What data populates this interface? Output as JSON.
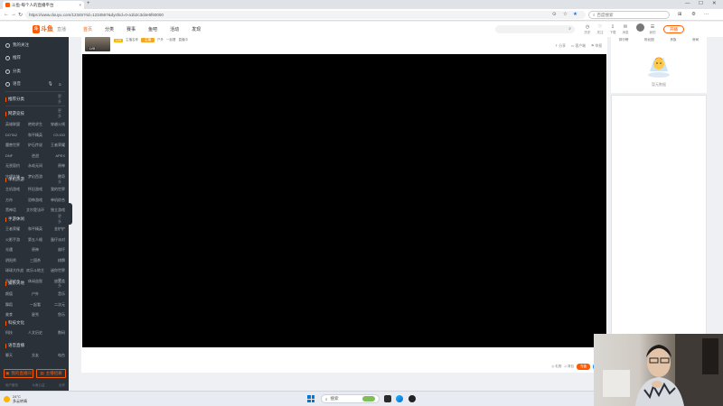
{
  "browser": {
    "tab_title": "斗鱼-每个人的直播平台",
    "url": "https://www.douyu.com/12345?rid=1234567&dyshid=0-a1b2c3d4e5f60000",
    "search_placeholder": "百度搜索"
  },
  "site": {
    "logo_mark": "斗",
    "logo_text": "斗鱼",
    "logo_sub": "直播",
    "nav": [
      "首页",
      "分类",
      "赛事",
      "鱼吧",
      "活动",
      "发现"
    ],
    "header_icons": [
      {
        "icon": "history-icon",
        "label": "历史"
      },
      {
        "icon": "follow-icon",
        "label": "关注"
      },
      {
        "icon": "download-icon",
        "label": "下载"
      },
      {
        "icon": "message-icon",
        "label": "消息"
      },
      {
        "icon": "user-icon",
        "label": "我的"
      }
    ],
    "start_live": "开播"
  },
  "sidebar": {
    "top_items": [
      "我的关注",
      "推荐",
      "分类"
    ],
    "voice_item": "语音",
    "sections": [
      {
        "title": "推荐分类",
        "more": "更多",
        "items": []
      },
      {
        "title": "网游竞技",
        "more": "更多",
        "items": [
          "英雄联盟",
          "绝地求生",
          "穿越火线",
          "DOTA2",
          "和平精英",
          "CS:GO",
          "魔兽世界",
          "炉石传说",
          "王者荣耀",
          "DNF",
          "逆战",
          "APEX",
          "无畏契约",
          "永劫无间",
          "原神",
          "守望先锋",
          "梦幻西游",
          "传奇"
        ]
      },
      {
        "title": "单机热游",
        "more": "更多",
        "items": [
          "主机游戏",
          "怀旧游戏",
          "我的世界",
          "方舟",
          "恐怖游戏",
          "单机综合",
          "黑神话",
          "艾尔登法环",
          "独立游戏"
        ]
      },
      {
        "title": "手游休闲",
        "more": "更多",
        "items": [
          "王者荣耀",
          "和平精英",
          "金铲铲",
          "火影手游",
          "第五人格",
          "蛋仔派对",
          "光遇",
          "原神",
          "崩坏",
          "阴阳师",
          "三国杀",
          "棋牌",
          "球球大作战",
          "欢乐斗地主",
          "迷你世界",
          "手游综合",
          "休闲益智",
          "放置类"
        ]
      },
      {
        "title": "娱乐天地",
        "more": "更多",
        "items": [
          "颜值",
          "户外",
          "音乐",
          "舞蹈",
          "一起看",
          "二次元",
          "美食",
          "星秀",
          "鱼乐"
        ]
      },
      {
        "title": "科技文化",
        "more": "",
        "items": [
          "科技",
          "人文历史",
          "数码"
        ]
      },
      {
        "title": "语音直播",
        "more": "",
        "items": [
          "聊天",
          "交友",
          "电台"
        ]
      }
    ],
    "btn_left": "我的直播间",
    "btn_right": "主播招募",
    "footer": [
      "用户服务",
      "斗鱼公益",
      "合作"
    ]
  },
  "room": {
    "badge": "LV8",
    "level": "LV9",
    "level2": "主播",
    "meta_name": "主播名称",
    "meta_tags": [
      "户外",
      "一起看",
      "直播中"
    ],
    "actions": [
      "分享",
      "客户端",
      "举报"
    ]
  },
  "bottom_bar": {
    "items": [
      "礼物",
      "背包"
    ],
    "pill_orange": "充值",
    "pill_blue": "贵族"
  },
  "right_panel": {
    "buttons": [
      "排行榜",
      "粉丝团",
      "贵族",
      "房间"
    ],
    "caption": "暂无数据"
  },
  "taskbar": {
    "weather_temp": "24°C",
    "weather_desc": "多云转晴",
    "search_text": "搜索"
  }
}
